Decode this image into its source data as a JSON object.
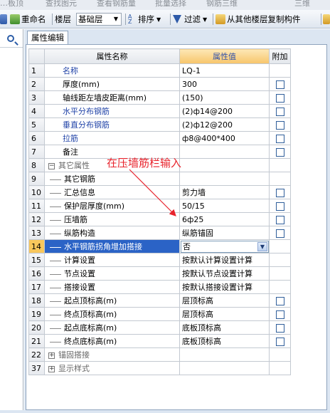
{
  "top_menu": [
    "…板顶",
    "查找图元",
    "查看钢筋量",
    "批量选择",
    "钢筋三维",
    "三维"
  ],
  "toolbar": {
    "rename_label": "重命名",
    "floor_label": "楼层",
    "floor_value": "基础层",
    "sort_label": "排序",
    "filter_label": "过滤",
    "copy_label": "从其他楼层复制构件"
  },
  "tab": {
    "label": "属性编辑"
  },
  "grid": {
    "headers": {
      "name": "属性名称",
      "value": "属性值",
      "add": "附加"
    },
    "rows": [
      {
        "num": "1",
        "name": "名称",
        "value": "LQ-1",
        "style": "blue",
        "check": false
      },
      {
        "num": "2",
        "name": "厚度(mm)",
        "value": "300",
        "style": "normal",
        "check": true
      },
      {
        "num": "3",
        "name": "轴线距左墙皮距离(mm)",
        "value": "(150)",
        "style": "normal",
        "check": true
      },
      {
        "num": "4",
        "name": "水平分布钢筋",
        "value": "(2)ф14@200",
        "style": "blue",
        "check": true
      },
      {
        "num": "5",
        "name": "垂直分布钢筋",
        "value": "(2)ф12@200",
        "style": "blue",
        "check": true
      },
      {
        "num": "6",
        "name": "拉筋",
        "value": "ф8@400*400",
        "style": "blue",
        "check": true
      },
      {
        "num": "7",
        "name": "备注",
        "value": "",
        "style": "normal",
        "check": true
      },
      {
        "num": "8",
        "name": "其它属性",
        "value": "",
        "style": "group",
        "check": false
      },
      {
        "num": "9",
        "name": "其它钢筋",
        "value": "",
        "style": "child",
        "check": false
      },
      {
        "num": "10",
        "name": "汇总信息",
        "value": "剪力墙",
        "style": "child",
        "check": true
      },
      {
        "num": "11",
        "name": "保护层厚度(mm)",
        "value": "50/15",
        "style": "child",
        "check": true
      },
      {
        "num": "12",
        "name": "压墙筋",
        "value": "6ф25",
        "style": "child",
        "check": true
      },
      {
        "num": "13",
        "name": "纵筋构造",
        "value": "纵筋锚固",
        "style": "child",
        "check": true
      },
      {
        "num": "14",
        "name": "水平钢筋拐角增加搭接",
        "value": "否",
        "style": "active",
        "check": false
      },
      {
        "num": "15",
        "name": "计算设置",
        "value": "按默认计算设置计算",
        "style": "child",
        "check": false
      },
      {
        "num": "16",
        "name": "节点设置",
        "value": "按默认节点设置计算",
        "style": "child",
        "check": false
      },
      {
        "num": "17",
        "name": "搭接设置",
        "value": "按默认搭接设置计算",
        "style": "child",
        "check": false
      },
      {
        "num": "18",
        "name": "起点顶标高(m)",
        "value": "层顶标高",
        "style": "child",
        "check": true
      },
      {
        "num": "19",
        "name": "终点顶标高(m)",
        "value": "层顶标高",
        "style": "child",
        "check": true
      },
      {
        "num": "20",
        "name": "起点底标高(m)",
        "value": "底板顶标高",
        "style": "child",
        "check": true
      },
      {
        "num": "21",
        "name": "终点底标高(m)",
        "value": "底板顶标高",
        "style": "child",
        "check": true
      },
      {
        "num": "22",
        "name": "锚固搭接",
        "value": "",
        "style": "collapsed",
        "check": false
      },
      {
        "num": "37",
        "name": "显示样式",
        "value": "",
        "style": "collapsed",
        "check": false
      }
    ]
  },
  "annotation": {
    "text": "在压墙筋栏输入",
    "color": "#e8232c"
  },
  "colors": {
    "active_row": "#2b63c6",
    "header_value": "#f7c56a",
    "link_blue": "#2244a8"
  }
}
